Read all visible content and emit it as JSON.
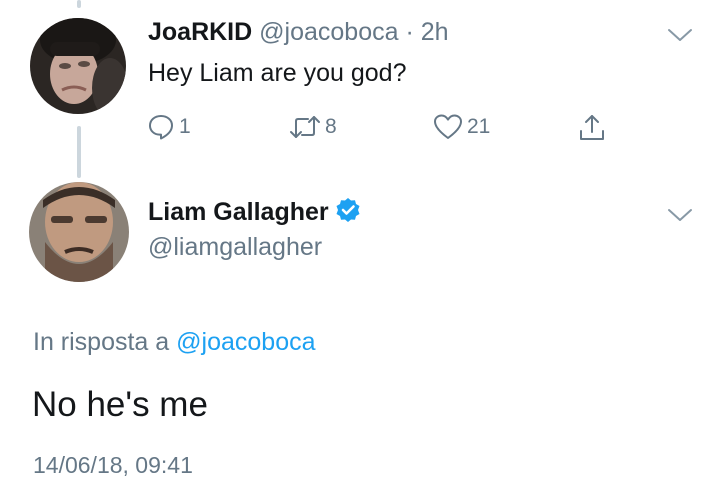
{
  "reply_tweet": {
    "display_name": "JoaRKID",
    "handle": "@joacoboca",
    "separator": "·",
    "time": "2h",
    "text": "Hey Liam are you god?",
    "actions": {
      "reply_count": "1",
      "retweet_count": "8",
      "like_count": "21"
    }
  },
  "main_tweet": {
    "display_name": "Liam Gallagher",
    "handle": "@liamgallagher",
    "reply_prefix": "In risposta a",
    "reply_mention": "@joacoboca",
    "text": "No he's me",
    "timestamp": "14/06/18, 09:41"
  },
  "colors": {
    "accent": "#1da1f2",
    "muted": "#657786",
    "text": "#14171a",
    "thread_line": "#ccd6dd"
  }
}
